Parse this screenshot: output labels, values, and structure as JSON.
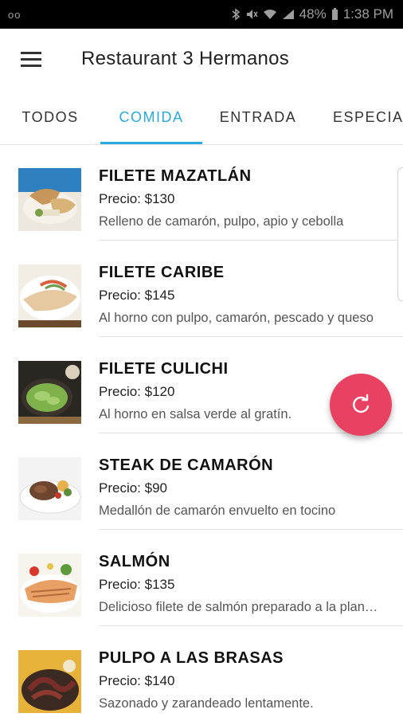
{
  "status_bar": {
    "left": "oo",
    "battery_text": "48%",
    "time": "1:38 PM",
    "icons": [
      "bluetooth-icon",
      "mute-icon",
      "wifi-icon",
      "signal-icon",
      "battery-icon"
    ]
  },
  "app_bar": {
    "menu_icon": "hamburger-menu-icon",
    "title": "Restaurant 3 Hermanos"
  },
  "tabs": [
    {
      "label": "TODOS",
      "active": false
    },
    {
      "label": "COMIDA",
      "active": true
    },
    {
      "label": "ENTRADA",
      "active": false
    },
    {
      "label": "ESPECIAL",
      "active": false
    }
  ],
  "items": [
    {
      "name": "FILETE MAZATLÁN",
      "price": "Precio: $130",
      "description": "Relleno de camarón, pulpo, apio y cebolla"
    },
    {
      "name": "FILETE CARIBE",
      "price": "Precio: $145",
      "description": "Al horno con pulpo, camarón, pescado y queso"
    },
    {
      "name": "FILETE CULICHI",
      "price": "Precio: $120",
      "description": "Al horno en salsa verde al gratín."
    },
    {
      "name": "STEAK DE CAMARÓN",
      "price": "Precio: $90",
      "description": "Medallón de camarón envuelto en tocino"
    },
    {
      "name": "SALMÓN",
      "price": "Precio: $135",
      "description": "Delicioso filete de salmón preparado a la plancha"
    },
    {
      "name": "PULPO A LAS BRASAS",
      "price": "Precio: $140",
      "description": "Sazonado y zarandeado lentamente."
    }
  ],
  "fab": {
    "icon": "refresh-icon"
  },
  "colors": {
    "accent": "#29a9e1",
    "fab": "#e94161"
  }
}
